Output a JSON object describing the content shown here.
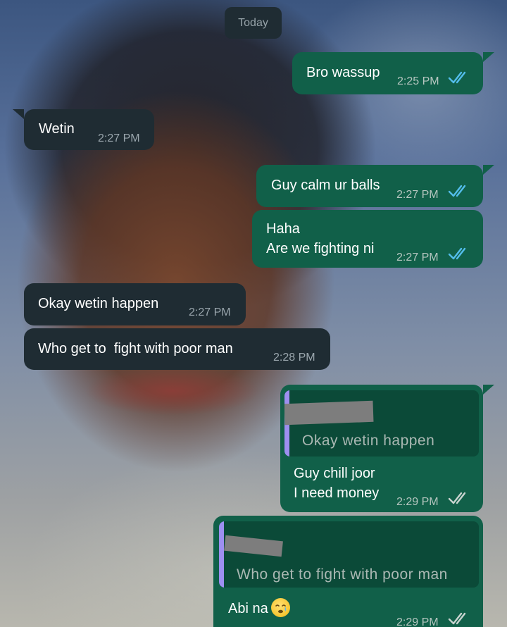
{
  "chat": {
    "date_label": "Today",
    "messages": [
      {
        "id": "m1",
        "direction": "out",
        "text": "Bro wassup",
        "time": "2:25 PM",
        "status": "read"
      },
      {
        "id": "m2",
        "direction": "in",
        "text": "Wetin",
        "time": "2:27 PM"
      },
      {
        "id": "m3",
        "direction": "out",
        "text": "Guy calm ur balls",
        "time": "2:27 PM",
        "status": "read"
      },
      {
        "id": "m4",
        "direction": "out",
        "line1": "Haha",
        "line2": "Are we fighting ni",
        "time": "2:27 PM",
        "status": "read"
      },
      {
        "id": "m5",
        "direction": "in",
        "text": "Okay wetin happen",
        "time": "2:27 PM"
      },
      {
        "id": "m6",
        "direction": "in",
        "text": "Who get to  fight with poor man",
        "time": "2:28 PM"
      },
      {
        "id": "m7",
        "direction": "out",
        "quote": "Okay wetin happen",
        "line1": "Guy chill joor",
        "line2": "I need money",
        "time": "2:29 PM",
        "status": "delivered"
      },
      {
        "id": "m8",
        "direction": "out",
        "quote": "Who get to  fight with poor man",
        "text": "Abi na",
        "emoji": "crying-face-emoji",
        "time": "2:29 PM",
        "status": "delivered"
      }
    ]
  },
  "colors": {
    "outgoing_bubble": "#116049",
    "incoming_bubble": "#1f2c33",
    "read_ticks": "#53bdeb",
    "delivered_ticks": "#c8d3cf",
    "quote_bar": "#9d8ff0"
  }
}
